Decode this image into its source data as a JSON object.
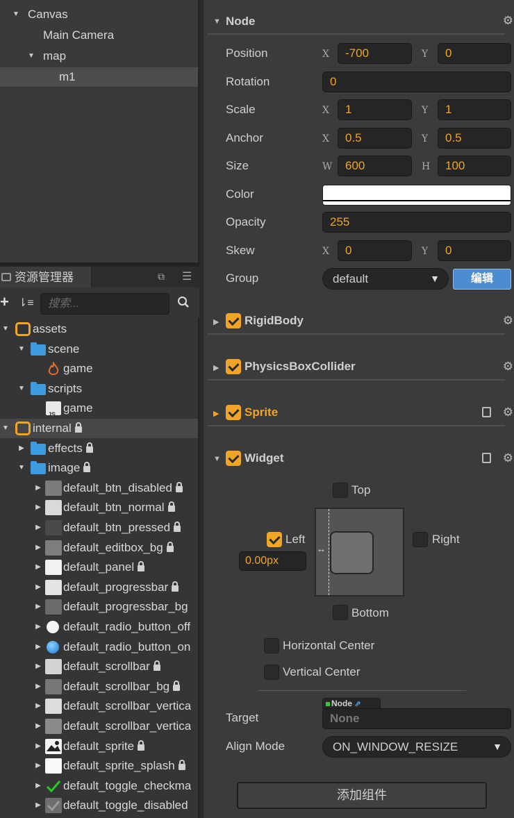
{
  "hierarchy": {
    "items": [
      {
        "label": "Canvas",
        "expanded": true
      },
      {
        "label": "Main Camera"
      },
      {
        "label": "map",
        "expanded": true
      },
      {
        "label": "m1",
        "selected": true
      }
    ]
  },
  "assets_panel": {
    "tab_label": "资源管理器",
    "search_placeholder": "搜索...",
    "items": [
      {
        "label": "assets",
        "type": "db"
      },
      {
        "label": "scene",
        "type": "folder"
      },
      {
        "label": "game",
        "type": "scene-fire"
      },
      {
        "label": "scripts",
        "type": "folder"
      },
      {
        "label": "game",
        "type": "js"
      },
      {
        "label": "internal",
        "type": "db",
        "locked": true
      },
      {
        "label": "effects",
        "type": "folder",
        "locked": true
      },
      {
        "label": "image",
        "type": "folder",
        "locked": true
      },
      {
        "label": "default_btn_disabled",
        "locked": true
      },
      {
        "label": "default_btn_normal",
        "locked": true
      },
      {
        "label": "default_btn_pressed",
        "locked": true
      },
      {
        "label": "default_editbox_bg",
        "locked": true
      },
      {
        "label": "default_panel",
        "locked": true
      },
      {
        "label": "default_progressbar",
        "locked": true
      },
      {
        "label": "default_progressbar_bg",
        "locked": false
      },
      {
        "label": "default_radio_button_off",
        "locked": false
      },
      {
        "label": "default_radio_button_on",
        "locked": false
      },
      {
        "label": "default_scrollbar",
        "locked": true
      },
      {
        "label": "default_scrollbar_bg",
        "locked": true
      },
      {
        "label": "default_scrollbar_vertica",
        "locked": false
      },
      {
        "label": "default_scrollbar_vertica",
        "locked": false
      },
      {
        "label": "default_sprite",
        "locked": true
      },
      {
        "label": "default_sprite_splash",
        "locked": true
      },
      {
        "label": "default_toggle_checkma",
        "locked": false
      },
      {
        "label": "default_toggle_disabled",
        "locked": false
      }
    ]
  },
  "inspector": {
    "node_section": "Node",
    "position": {
      "label": "Position",
      "x_axis": "X",
      "x": "-700",
      "y_axis": "Y",
      "y": "0"
    },
    "rotation": {
      "label": "Rotation",
      "value": "0"
    },
    "scale": {
      "label": "Scale",
      "x_axis": "X",
      "x": "1",
      "y_axis": "Y",
      "y": "1"
    },
    "anchor": {
      "label": "Anchor",
      "x_axis": "X",
      "x": "0.5",
      "y_axis": "Y",
      "y": "0.5"
    },
    "size": {
      "label": "Size",
      "w_axis": "W",
      "w": "600",
      "h_axis": "H",
      "h": "100"
    },
    "color": {
      "label": "Color",
      "value": "#ffffff"
    },
    "opacity": {
      "label": "Opacity",
      "value": "255"
    },
    "skew": {
      "label": "Skew",
      "x_axis": "X",
      "x": "0",
      "y_axis": "Y",
      "y": "0"
    },
    "group": {
      "label": "Group",
      "value": "default",
      "edit_label": "编辑"
    },
    "components": [
      {
        "title": "RigidBody",
        "enabled": true,
        "expanded": false
      },
      {
        "title": "PhysicsBoxCollider",
        "enabled": true,
        "expanded": false
      },
      {
        "title": "Sprite",
        "enabled": true,
        "expanded": false,
        "highlight": true
      },
      {
        "title": "Widget",
        "enabled": true,
        "expanded": true
      }
    ],
    "widget": {
      "top": {
        "label": "Top",
        "checked": false
      },
      "left": {
        "label": "Left",
        "checked": true,
        "value": "0.00px"
      },
      "right": {
        "label": "Right",
        "checked": false
      },
      "bottom": {
        "label": "Bottom",
        "checked": false
      },
      "horizontal_center": {
        "label": "Horizontal Center",
        "checked": false
      },
      "vertical_center": {
        "label": "Vertical Center",
        "checked": false
      },
      "target": {
        "label": "Target",
        "tag": "Node",
        "value": "None"
      },
      "align_mode": {
        "label": "Align Mode",
        "value": "ON_WINDOW_RESIZE"
      }
    },
    "add_component_label": "添加组件"
  },
  "colors": {
    "accent": "#f0a526",
    "button_blue": "#4b8dcf",
    "folder_blue": "#3d9be0"
  }
}
